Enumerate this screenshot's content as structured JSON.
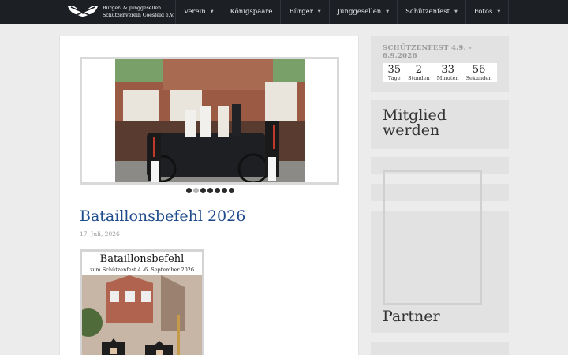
{
  "logo": {
    "line1": "Bürger- & Junggesellen",
    "line2": "Schützenverein Coesfeld e.V."
  },
  "nav": [
    {
      "label": "Verein",
      "dropdown": true
    },
    {
      "label": "Königspaare",
      "dropdown": false
    },
    {
      "label": "Bürger",
      "dropdown": true
    },
    {
      "label": "Junggesellen",
      "dropdown": true
    },
    {
      "label": "Schützenfest",
      "dropdown": true
    },
    {
      "label": "Fotos",
      "dropdown": true
    }
  ],
  "slider": {
    "dot_count": 7,
    "active_index": 1
  },
  "post": {
    "title": "Bataillonsbefehl 2026",
    "date": "17. Juli, 2026",
    "poster_title": "Bataillonsbefehl",
    "poster_subtitle": "zum Schützenfest 4.-6. September 2026"
  },
  "sidebar": {
    "countdown_title": "SCHÜTZENFEST 4.9. - 6.9.2026",
    "countdown": [
      {
        "value": "35",
        "label": "Tage"
      },
      {
        "value": "2",
        "label": "Stunden"
      },
      {
        "value": "33",
        "label": "Minuten"
      },
      {
        "value": "56",
        "label": "Sekunden"
      }
    ],
    "member_title_line1": "Mitglied",
    "member_title_line2": "werden",
    "partner_title": "Partner"
  },
  "colors": {
    "navbar": "#1c1f24",
    "title_blue": "#1e4b8c",
    "sidebar_bg": "#e2e2e2"
  }
}
